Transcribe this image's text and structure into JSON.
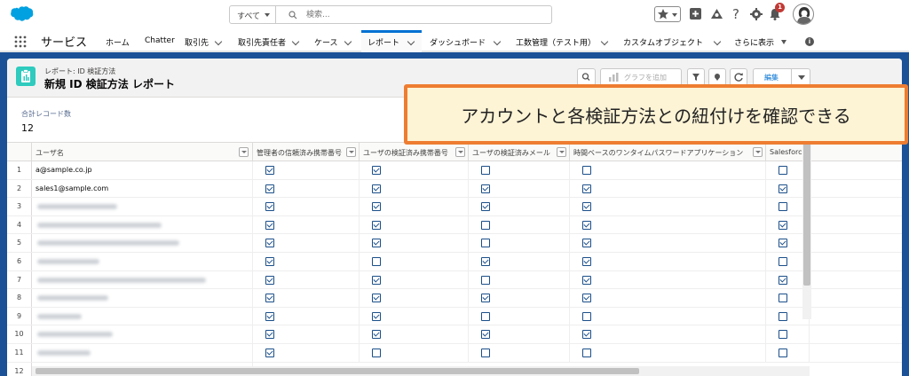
{
  "header": {
    "search_scope": "すべて",
    "search_placeholder": "検索...",
    "notification_count": "1"
  },
  "nav": {
    "app_name": "サービス",
    "items": [
      {
        "label": "ホーム",
        "chevron": false
      },
      {
        "label": "Chatter",
        "chevron": false
      },
      {
        "label": "取引先",
        "chevron": true
      },
      {
        "label": "取引先責任者",
        "chevron": true
      },
      {
        "label": "ケース",
        "chevron": true
      },
      {
        "label": "レポート",
        "chevron": true,
        "active": true
      },
      {
        "label": "ダッシュボード",
        "chevron": true
      },
      {
        "label": "工数管理（テスト用）",
        "chevron": true
      },
      {
        "label": "カスタムオブジェクト",
        "chevron": true
      },
      {
        "label": "さらに表示",
        "chevron": false
      }
    ]
  },
  "report": {
    "breadcrumb": "レポート: ID 検証方法",
    "title": "新規 ID 検証方法 レポート",
    "add_chart_label": "グラフを追加",
    "edit_label": "編集",
    "total_label": "合計レコード数",
    "total_value": "12"
  },
  "table": {
    "columns": [
      "ユーザ名",
      "管理者の信頼済み携帯番号",
      "ユーザの検証済み携帯番号",
      "ユーザの検証済みメール",
      "時間ベースのワンタイムパスワードアプリケーション",
      "Salesforce A"
    ],
    "rows": [
      {
        "num": "1",
        "name": "a@sample.co.jp",
        "checks": [
          true,
          true,
          false,
          false,
          false
        ]
      },
      {
        "num": "2",
        "name": "sales1@sample.com",
        "checks": [
          true,
          true,
          true,
          true,
          true
        ]
      },
      {
        "num": "3",
        "name": "",
        "checks": [
          true,
          true,
          true,
          true,
          false
        ]
      },
      {
        "num": "4",
        "name": "",
        "checks": [
          true,
          true,
          false,
          true,
          true
        ]
      },
      {
        "num": "5",
        "name": "",
        "checks": [
          true,
          true,
          false,
          true,
          true
        ]
      },
      {
        "num": "6",
        "name": "",
        "checks": [
          true,
          false,
          true,
          true,
          false
        ]
      },
      {
        "num": "7",
        "name": "",
        "checks": [
          true,
          true,
          false,
          true,
          true
        ]
      },
      {
        "num": "8",
        "name": "",
        "checks": [
          true,
          true,
          true,
          true,
          false
        ]
      },
      {
        "num": "9",
        "name": "",
        "checks": [
          true,
          true,
          false,
          false,
          false
        ]
      },
      {
        "num": "10",
        "name": "",
        "checks": [
          true,
          true,
          true,
          true,
          false
        ]
      },
      {
        "num": "11",
        "name": "",
        "checks": [
          true,
          false,
          false,
          false,
          false
        ]
      },
      {
        "num": "12",
        "name": "",
        "checks": []
      }
    ]
  },
  "callout": {
    "text": "アカウントと各検証方法との紐付けを確認できる"
  },
  "colors": {
    "brand_blue": "#0070d2",
    "content_bg": "#1b5297",
    "report_icon": "#2ecbbe",
    "callout_border": "#ee7d31",
    "callout_fill": "#fdf3d5"
  }
}
